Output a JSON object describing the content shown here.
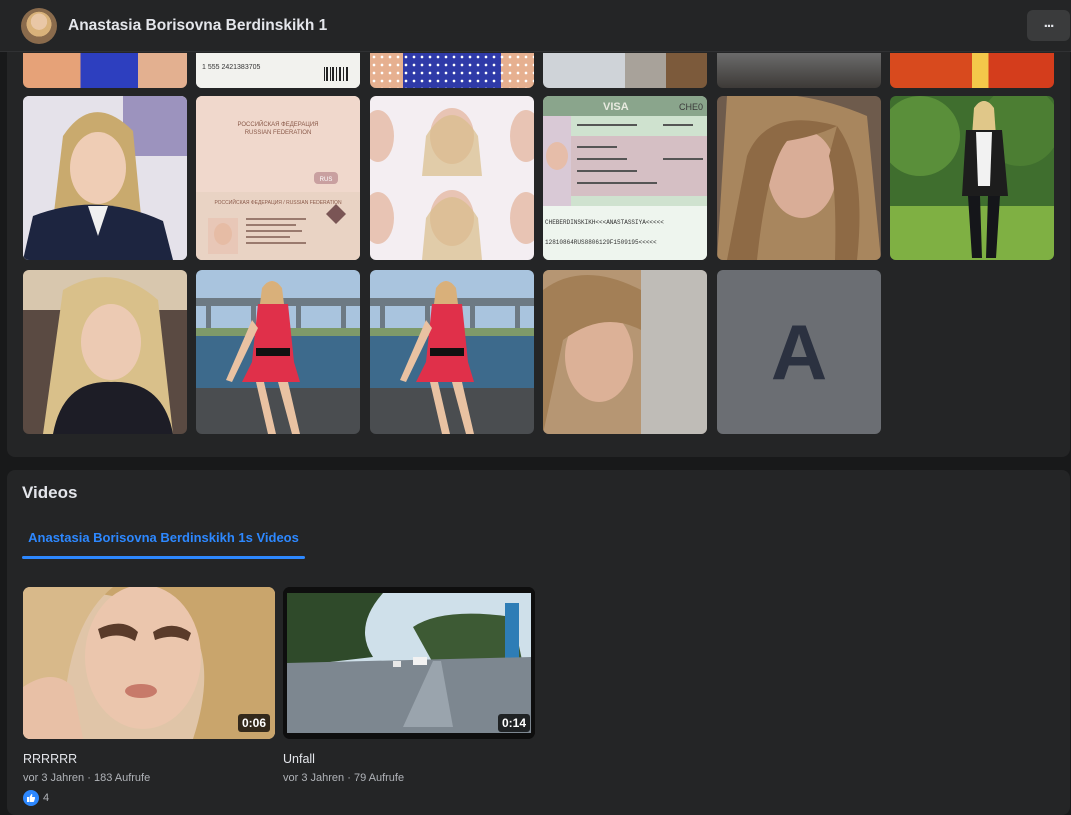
{
  "header": {
    "title": "Anastasia Borisovna Berdinskikh 1",
    "more_label": "..."
  },
  "photos": {
    "partial_row_text": "1 555 2421383705",
    "letter_tile": "A"
  },
  "videos": {
    "heading": "Videos",
    "tab_label": "Anastasia Borisovna Berdinskikh 1s Videos",
    "items": [
      {
        "title": "RRRRRR",
        "duration": "0:06",
        "age": "vor 3 Jahren",
        "views": "183 Aufrufe",
        "likes": "4"
      },
      {
        "title": "Unfall",
        "duration": "0:14",
        "age": "vor 3 Jahren",
        "views": "79 Aufrufe"
      }
    ],
    "separator": "·"
  },
  "colors": {
    "background": "#18191a",
    "card": "#242526",
    "accent": "#2d88ff"
  }
}
